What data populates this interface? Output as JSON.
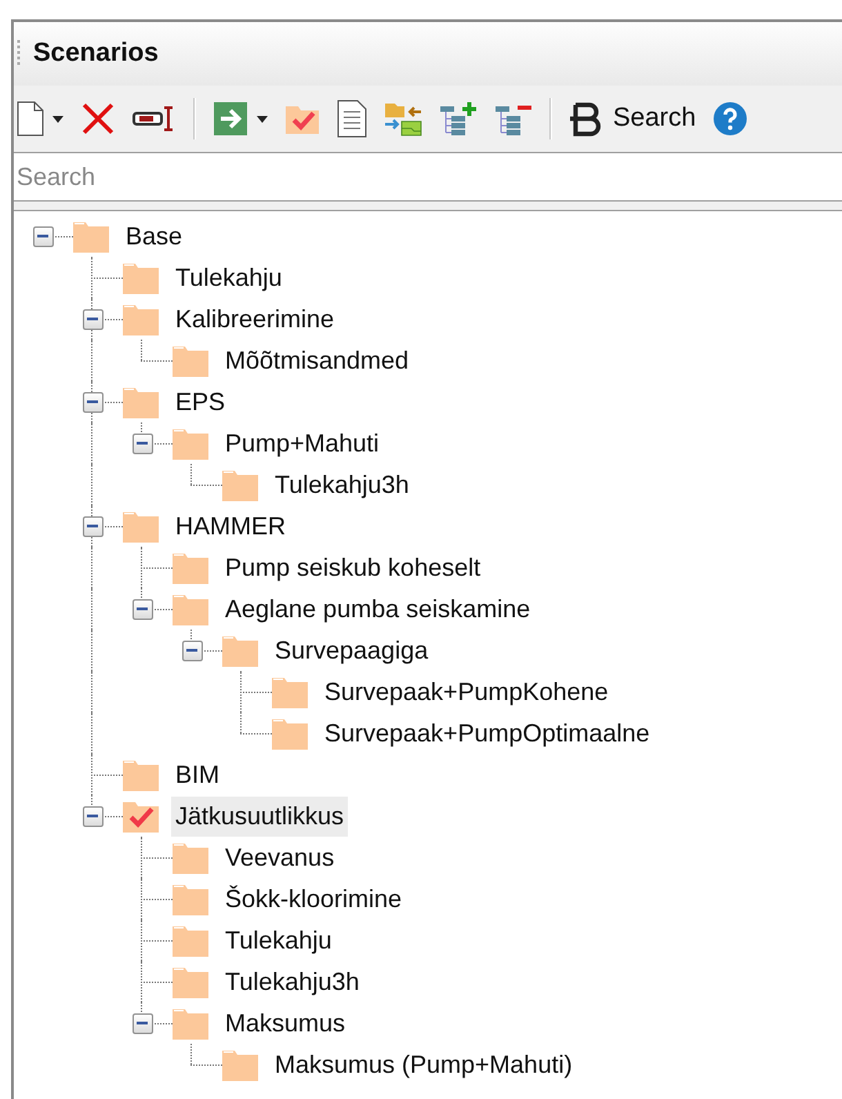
{
  "panel": {
    "title": "Scenarios"
  },
  "toolbar": [
    {
      "kind": "new",
      "dropdown": true
    },
    {
      "kind": "delete"
    },
    {
      "kind": "rename"
    },
    {
      "kind": "separator"
    },
    {
      "kind": "run",
      "dropdown": true
    },
    {
      "kind": "activate"
    },
    {
      "kind": "report"
    },
    {
      "kind": "compare"
    },
    {
      "kind": "add-level"
    },
    {
      "kind": "remove-level"
    },
    {
      "kind": "separator"
    },
    {
      "kind": "search",
      "label": "Search"
    },
    {
      "kind": "help"
    }
  ],
  "search": {
    "placeholder": "Search"
  },
  "tree": [
    {
      "label": "Base",
      "expanded": true,
      "active": false,
      "selected": false,
      "children": [
        {
          "label": "Tulekahju",
          "active": false,
          "selected": false
        },
        {
          "label": "Kalibreerimine",
          "expanded": true,
          "active": false,
          "selected": false,
          "children": [
            {
              "label": "Mõõtmisandmed",
              "active": false,
              "selected": false
            }
          ]
        },
        {
          "label": "EPS",
          "expanded": true,
          "active": false,
          "selected": false,
          "children": [
            {
              "label": "Pump+Mahuti",
              "expanded": true,
              "active": false,
              "selected": false,
              "children": [
                {
                  "label": "Tulekahju3h",
                  "active": false,
                  "selected": false
                }
              ]
            }
          ]
        },
        {
          "label": "HAMMER",
          "expanded": true,
          "active": false,
          "selected": false,
          "children": [
            {
              "label": "Pump seiskub koheselt",
              "active": false,
              "selected": false
            },
            {
              "label": "Aeglane pumba seiskamine",
              "expanded": true,
              "active": false,
              "selected": false,
              "children": [
                {
                  "label": "Survepaagiga",
                  "expanded": true,
                  "active": false,
                  "selected": false,
                  "children": [
                    {
                      "label": "Survepaak+PumpKohene",
                      "active": false,
                      "selected": false
                    },
                    {
                      "label": "Survepaak+PumpOptimaalne",
                      "active": false,
                      "selected": false
                    }
                  ]
                }
              ]
            }
          ]
        },
        {
          "label": "BIM",
          "active": false,
          "selected": false
        },
        {
          "label": "Jätkusuutlikkus",
          "expanded": true,
          "active": true,
          "selected": true,
          "children": [
            {
              "label": "Veevanus",
              "active": false,
              "selected": false
            },
            {
              "label": "Šokk-kloorimine",
              "active": false,
              "selected": false
            },
            {
              "label": "Tulekahju",
              "active": false,
              "selected": false
            },
            {
              "label": "Tulekahju3h",
              "active": false,
              "selected": false
            },
            {
              "label": "Maksumus",
              "expanded": true,
              "active": false,
              "selected": false,
              "children": [
                {
                  "label": "Maksumus (Pump+Mahuti)",
                  "active": false,
                  "selected": false
                }
              ]
            }
          ]
        }
      ]
    }
  ]
}
